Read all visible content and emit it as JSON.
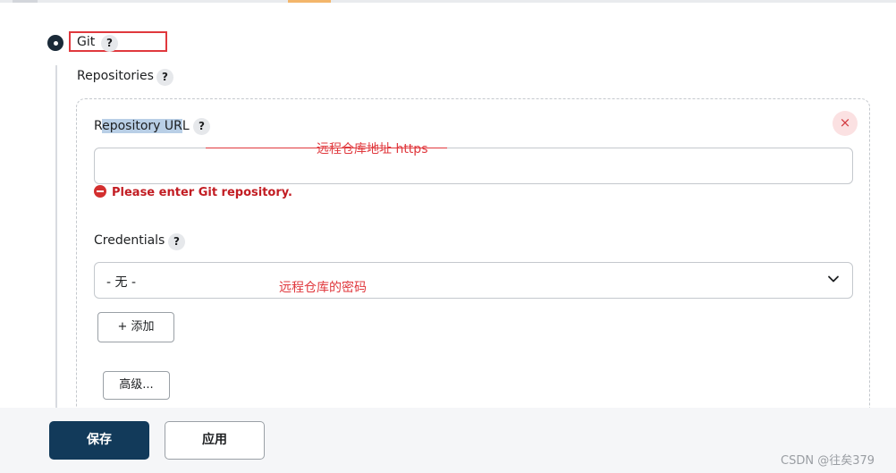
{
  "git": {
    "label": "Git",
    "help": "?"
  },
  "repositories": {
    "label": "Repositories",
    "help": "?"
  },
  "repository_url": {
    "label_highlighted": "epository UR",
    "label_prefix": "R",
    "label_suffix": "L",
    "help": "?",
    "value": "",
    "annotation": "远程仓库地址 https",
    "error": "Please enter Git repository.",
    "remove_icon": "×"
  },
  "credentials": {
    "label": "Credentials",
    "help": "?",
    "selected": "- 无 -",
    "annotation": "远程仓库的密码",
    "add_button": "+ 添加"
  },
  "advanced_button": "高级...",
  "footer": {
    "save": "保存",
    "apply": "应用"
  },
  "watermark": "CSDN @往矣379",
  "colors": {
    "primary": "#123a5a",
    "error": "#c21d23",
    "annotation": "#e0383d"
  }
}
